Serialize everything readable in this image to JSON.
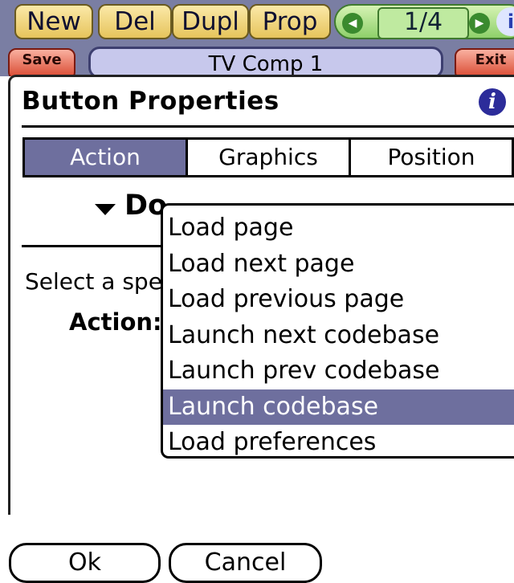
{
  "toolbar": {
    "buttons": [
      "New",
      "Del",
      "Dupl",
      "Prop"
    ],
    "page_counter": "1/4",
    "prev_icon": "left-arrow-icon",
    "next_icon": "right-arrow-icon",
    "info_label": "i",
    "save_label": "Save",
    "exit_label": "Exit",
    "device_name": "TV Comp 1"
  },
  "dialog": {
    "title": "Button Properties",
    "info_label": "i",
    "tabs": [
      {
        "label": "Action",
        "active": true
      },
      {
        "label": "Graphics",
        "active": false
      },
      {
        "label": "Position",
        "active": false
      }
    ],
    "trigger_text": "Do Special Action",
    "hint_text": "Select a special action",
    "action_label": "Action:",
    "popup_options": [
      "Load page",
      "Load next page",
      "Load previous page",
      "Launch next codebase",
      "Launch prev codebase",
      "Launch codebase",
      "Load preferences"
    ],
    "selected_index": 5,
    "ok_label": "Ok",
    "cancel_label": "Cancel"
  },
  "colors": {
    "selection": "#6e6f9e",
    "toolbar_bg": "#7a7ea3",
    "button_yellow": "#e6c45c",
    "nav_green": "#8ed06a",
    "info_blue": "#2c2c9a"
  }
}
